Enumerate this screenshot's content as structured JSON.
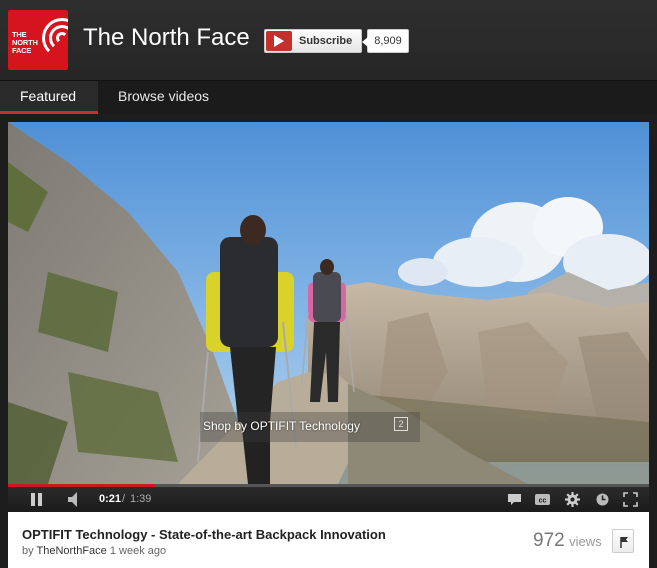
{
  "channel": {
    "logo_text": [
      "THE",
      "NORTH",
      "FACE"
    ],
    "title": "The North Face",
    "subscribe_label": "Subscribe",
    "subscriber_count": "8,909"
  },
  "nav": {
    "tabs": [
      {
        "label": "Featured",
        "active": true
      },
      {
        "label": "Browse videos",
        "active": false
      }
    ]
  },
  "player": {
    "annotation_text": "Shop by OPTIFIT Technology",
    "annotation_icon_label": "2",
    "progress_fraction": 0.23,
    "time_current": "0:21",
    "time_separator": "/",
    "time_total": "1:39",
    "controls": [
      "pause-icon",
      "volume-icon",
      "captions-icon",
      "cc-icon",
      "settings-icon",
      "watch-later-icon",
      "fullscreen-icon"
    ]
  },
  "video": {
    "title": "OPTIFIT Technology - State-of-the-art Backpack Innovation",
    "by_prefix": "by",
    "author": "TheNorthFace",
    "date": "1 week ago",
    "views_count": "972",
    "views_label": "views"
  },
  "colors": {
    "brand_red": "#d5141d",
    "youtube_red": "#c4302b",
    "progress_red": "#cc181e"
  }
}
